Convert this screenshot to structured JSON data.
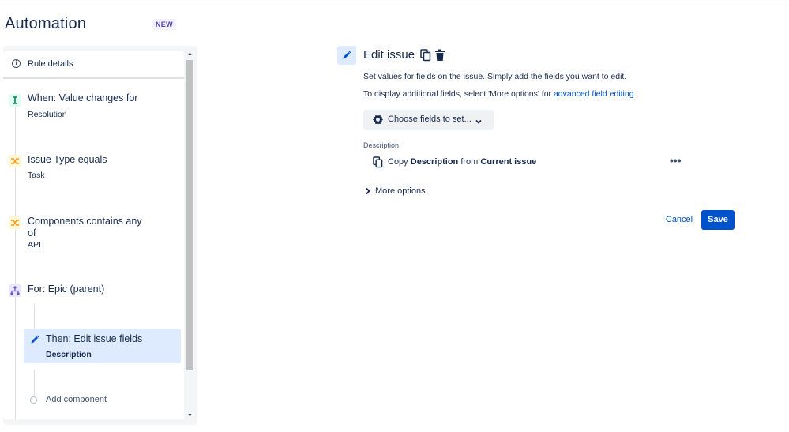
{
  "header": {
    "title": "Automation",
    "badge": "NEW"
  },
  "sidebar": {
    "rule_details": "Rule details",
    "steps": [
      {
        "title": "When: Value changes for",
        "sub": "Resolution",
        "icon": "trigger-icon"
      },
      {
        "title": "Issue Type equals",
        "sub": "Task",
        "icon": "condition-icon"
      },
      {
        "title_line1": "Components contains any",
        "title_line2": "of",
        "sub": "API",
        "icon": "condition-icon"
      },
      {
        "title": "For: Epic (parent)",
        "icon": "branch-icon"
      }
    ],
    "active_step": {
      "title": "Then: Edit issue fields",
      "sub": "Description"
    },
    "add_component": "Add component"
  },
  "main": {
    "title": "Edit issue",
    "desc1": "Set values for fields on the issue. Simply add the fields you want to edit.",
    "desc2_prefix": "To display additional fields, select 'More options' for ",
    "desc2_link": "advanced field editing",
    "desc2_suffix": ".",
    "choose_fields": "Choose fields to set...",
    "field_label": "Description",
    "copy_text": {
      "pre": "Copy ",
      "field": "Description",
      "mid": " from ",
      "source": "Current issue"
    },
    "more_dots": "•••",
    "more_options": "More options",
    "cancel": "Cancel",
    "save": "Save"
  },
  "colors": {
    "primary": "#0052CC",
    "active_bg": "#DEEBFF",
    "trigger": "#00875A",
    "condition": "#FF991F",
    "branch": "#6554C0"
  }
}
